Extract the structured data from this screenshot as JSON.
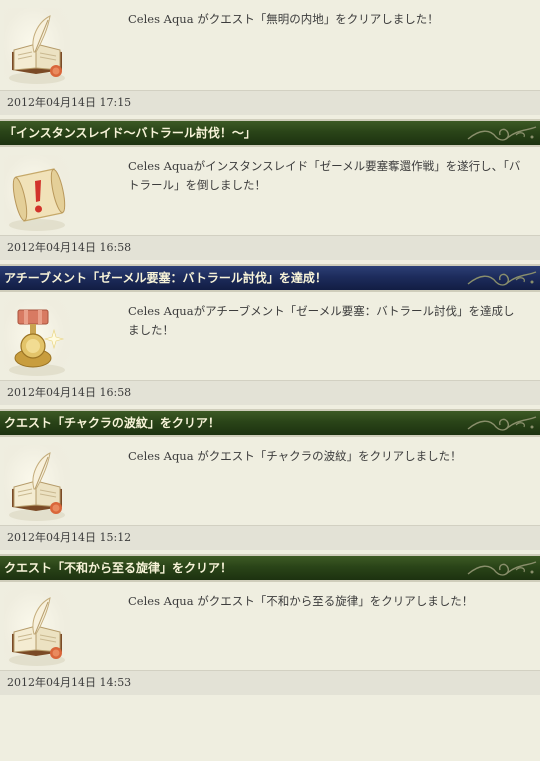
{
  "entries": [
    {
      "title": "",
      "header_style": "none",
      "icon": "open-book-quill-icon",
      "message": "Celes Aqua がクエスト「無明の内地」をクリアしました！",
      "timestamp": "2012年04月14日  17:15"
    },
    {
      "title": "「インスタンスレイド～バトラール討伐！～」",
      "header_style": "green",
      "icon": "scroll-exclamation-icon",
      "message": "Celes Aquaがインスタンスレイド「ゼーメル要塞奪還作戦」を遂行し、「バトラール」を倒しました！",
      "timestamp": "2012年04月14日  16:58"
    },
    {
      "title": "アチーブメント「ゼーメル要塞：バトラール討伐」を達成！",
      "header_style": "blue",
      "icon": "medal-icon",
      "message": "Celes Aquaがアチーブメント「ゼーメル要塞：バトラール討伐」を達成しました！",
      "timestamp": "2012年04月14日  16:58"
    },
    {
      "title": "クエスト「チャクラの波紋」をクリア！",
      "header_style": "green",
      "icon": "open-book-quill-icon",
      "message": "Celes Aqua がクエスト「チャクラの波紋」をクリアしました！",
      "timestamp": "2012年04月14日  15:12"
    },
    {
      "title": "クエスト「不和から至る旋律」をクリア！",
      "header_style": "green",
      "icon": "open-book-quill-icon",
      "message": "Celes Aqua がクエスト「不和から至る旋律」をクリアしました！",
      "timestamp": "2012年04月14日  14:53"
    }
  ],
  "colors": {
    "green_header": "#2a4418",
    "blue_header": "#1d2c5c",
    "header_text": "#f7f3d8",
    "background": "#efeee0",
    "footer": "#e3e2d6"
  }
}
